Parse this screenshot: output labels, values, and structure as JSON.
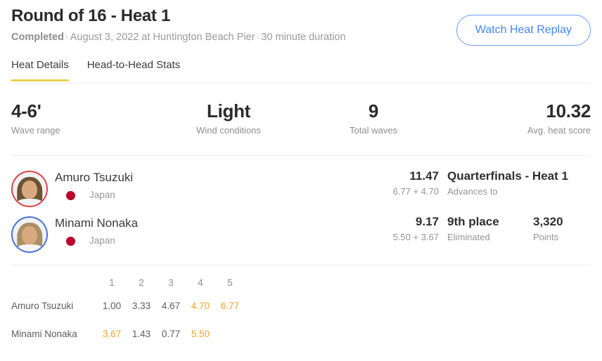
{
  "header": {
    "title": "Round of 16 - Heat 1",
    "status": "Completed",
    "separator": "·",
    "date": "August 3, 2022 at Huntington Beach Pier",
    "duration": "30 minute duration",
    "replay_button": "Watch Heat Replay"
  },
  "tabs": [
    {
      "label": "Heat Details",
      "active": true
    },
    {
      "label": "Head-to-Head Stats",
      "active": false
    }
  ],
  "stats": [
    {
      "value": "4-6'",
      "label": "Wave range"
    },
    {
      "value": "Light",
      "label": "Wind conditions"
    },
    {
      "value": "9",
      "label": "Total waves"
    },
    {
      "value": "10.32",
      "label": "Avg. heat score"
    }
  ],
  "athletes": [
    {
      "name": "Amuro Tsuzuki",
      "country": "Japan",
      "jersey_color": "#e0404a",
      "flag_color": "#bc002d",
      "total": "11.47",
      "parts": "6.77 + 4.70",
      "result_main": "Quarterfinals - Heat 1",
      "result_sub": "Advances to",
      "points": "",
      "points_label": ""
    },
    {
      "name": "Minami Nonaka",
      "country": "Japan",
      "jersey_color": "#4472d8",
      "flag_color": "#bc002d",
      "total": "9.17",
      "parts": "5.50 + 3.67",
      "result_main": "9th place",
      "result_sub": "Eliminated",
      "points": "3,320",
      "points_label": "Points"
    }
  ],
  "wave_table": {
    "columns": [
      "1",
      "2",
      "3",
      "4",
      "5"
    ],
    "rows": [
      {
        "label": "Amuro Tsuzuki",
        "scores": [
          "1.00",
          "3.33",
          "4.67",
          "4.70",
          "6.77"
        ],
        "counted": [
          false,
          false,
          false,
          true,
          true
        ]
      },
      {
        "label": "Minami Nonaka",
        "scores": [
          "3.67",
          "1.43",
          "0.77",
          "5.50",
          ""
        ],
        "counted": [
          true,
          false,
          false,
          true,
          false
        ]
      }
    ]
  },
  "colors": {
    "accent_blue": "#4285f4",
    "tab_underline": "#e8d14f",
    "counted_score": "#f0a32e",
    "divider": "#ededed"
  }
}
